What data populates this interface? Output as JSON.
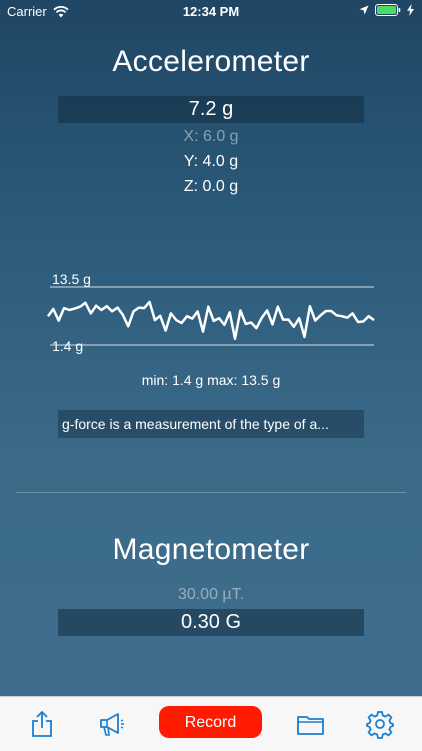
{
  "status_bar": {
    "carrier": "Carrier",
    "time": "12:34 PM",
    "battery_color": "#4cd964"
  },
  "accelerometer": {
    "title": "Accelerometer",
    "total": "7.2 g",
    "x": "X: 6.0 g",
    "y": "Y: 4.0 g",
    "z": "Z: 0.0 g",
    "graph": {
      "max_label": "13.5 g",
      "min_label": "1.4 g",
      "samples": [
        7.4,
        8.9,
        6.5,
        9.1,
        8.7,
        9.0,
        9.4,
        10.2,
        8.0,
        9.6,
        8.7,
        9.5,
        8.4,
        9.2,
        7.7,
        5.3,
        8.4,
        9.2,
        9.1,
        10.4,
        6.6,
        7.5,
        4.4,
        8.0,
        6.6,
        6.0,
        7.4,
        6.9,
        8.4,
        4.2,
        9.4,
        6.4,
        7.0,
        5.6,
        8.2,
        2.7,
        8.6,
        5.8,
        6.1,
        4.9,
        7.1,
        8.6,
        5.7,
        9.4,
        6.7,
        6.7,
        5.2,
        7.0,
        3.1,
        9.5,
        6.5,
        7.6,
        8.5,
        8.5,
        7.6,
        7.4,
        7.1,
        8.0,
        6.2,
        6.3,
        7.4,
        6.6
      ]
    },
    "minmax": "min: 1.4 g  max: 13.5 g",
    "description": "g-force is a measurement of the type of a..."
  },
  "magnetometer": {
    "title": "Magnetometer",
    "raw": "30.00  µT.",
    "value": "0.30  G"
  },
  "toolbar": {
    "record_label": "Record",
    "accent": "#1a7fd0",
    "record_color": "#ff1a00"
  }
}
